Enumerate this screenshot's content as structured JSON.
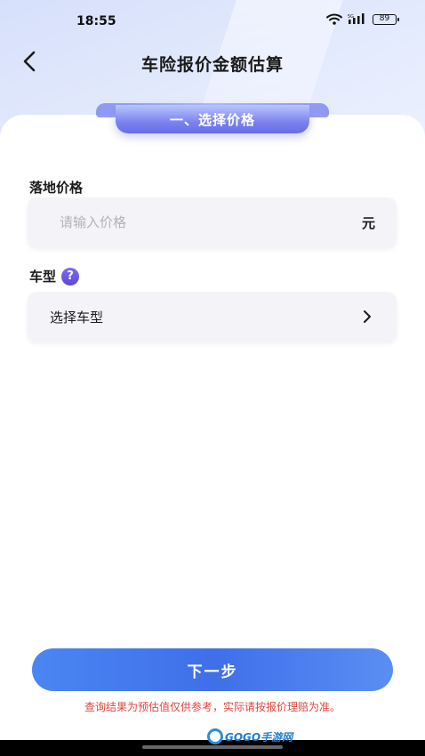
{
  "status_bar": {
    "time": "18:55",
    "battery": "89"
  },
  "header": {
    "title": "车险报价金额估算"
  },
  "section": {
    "label": "一、选择价格"
  },
  "form": {
    "price_label": "落地价格",
    "price_placeholder": "请输入价格",
    "price_unit": "元",
    "model_label": "车型",
    "help_glyph": "?",
    "model_value": "选择车型"
  },
  "footer": {
    "next_label": "下一步",
    "disclaimer": "查询结果为预估值仅供参考，实际请按报价理赔为准。"
  },
  "watermark": {
    "text": "GOGO手游网"
  },
  "colors": {
    "accent": "#3f6fe9",
    "ribbon": "#7c83ef",
    "help": "#5a49d8",
    "disclaimer": "#e0463c"
  }
}
